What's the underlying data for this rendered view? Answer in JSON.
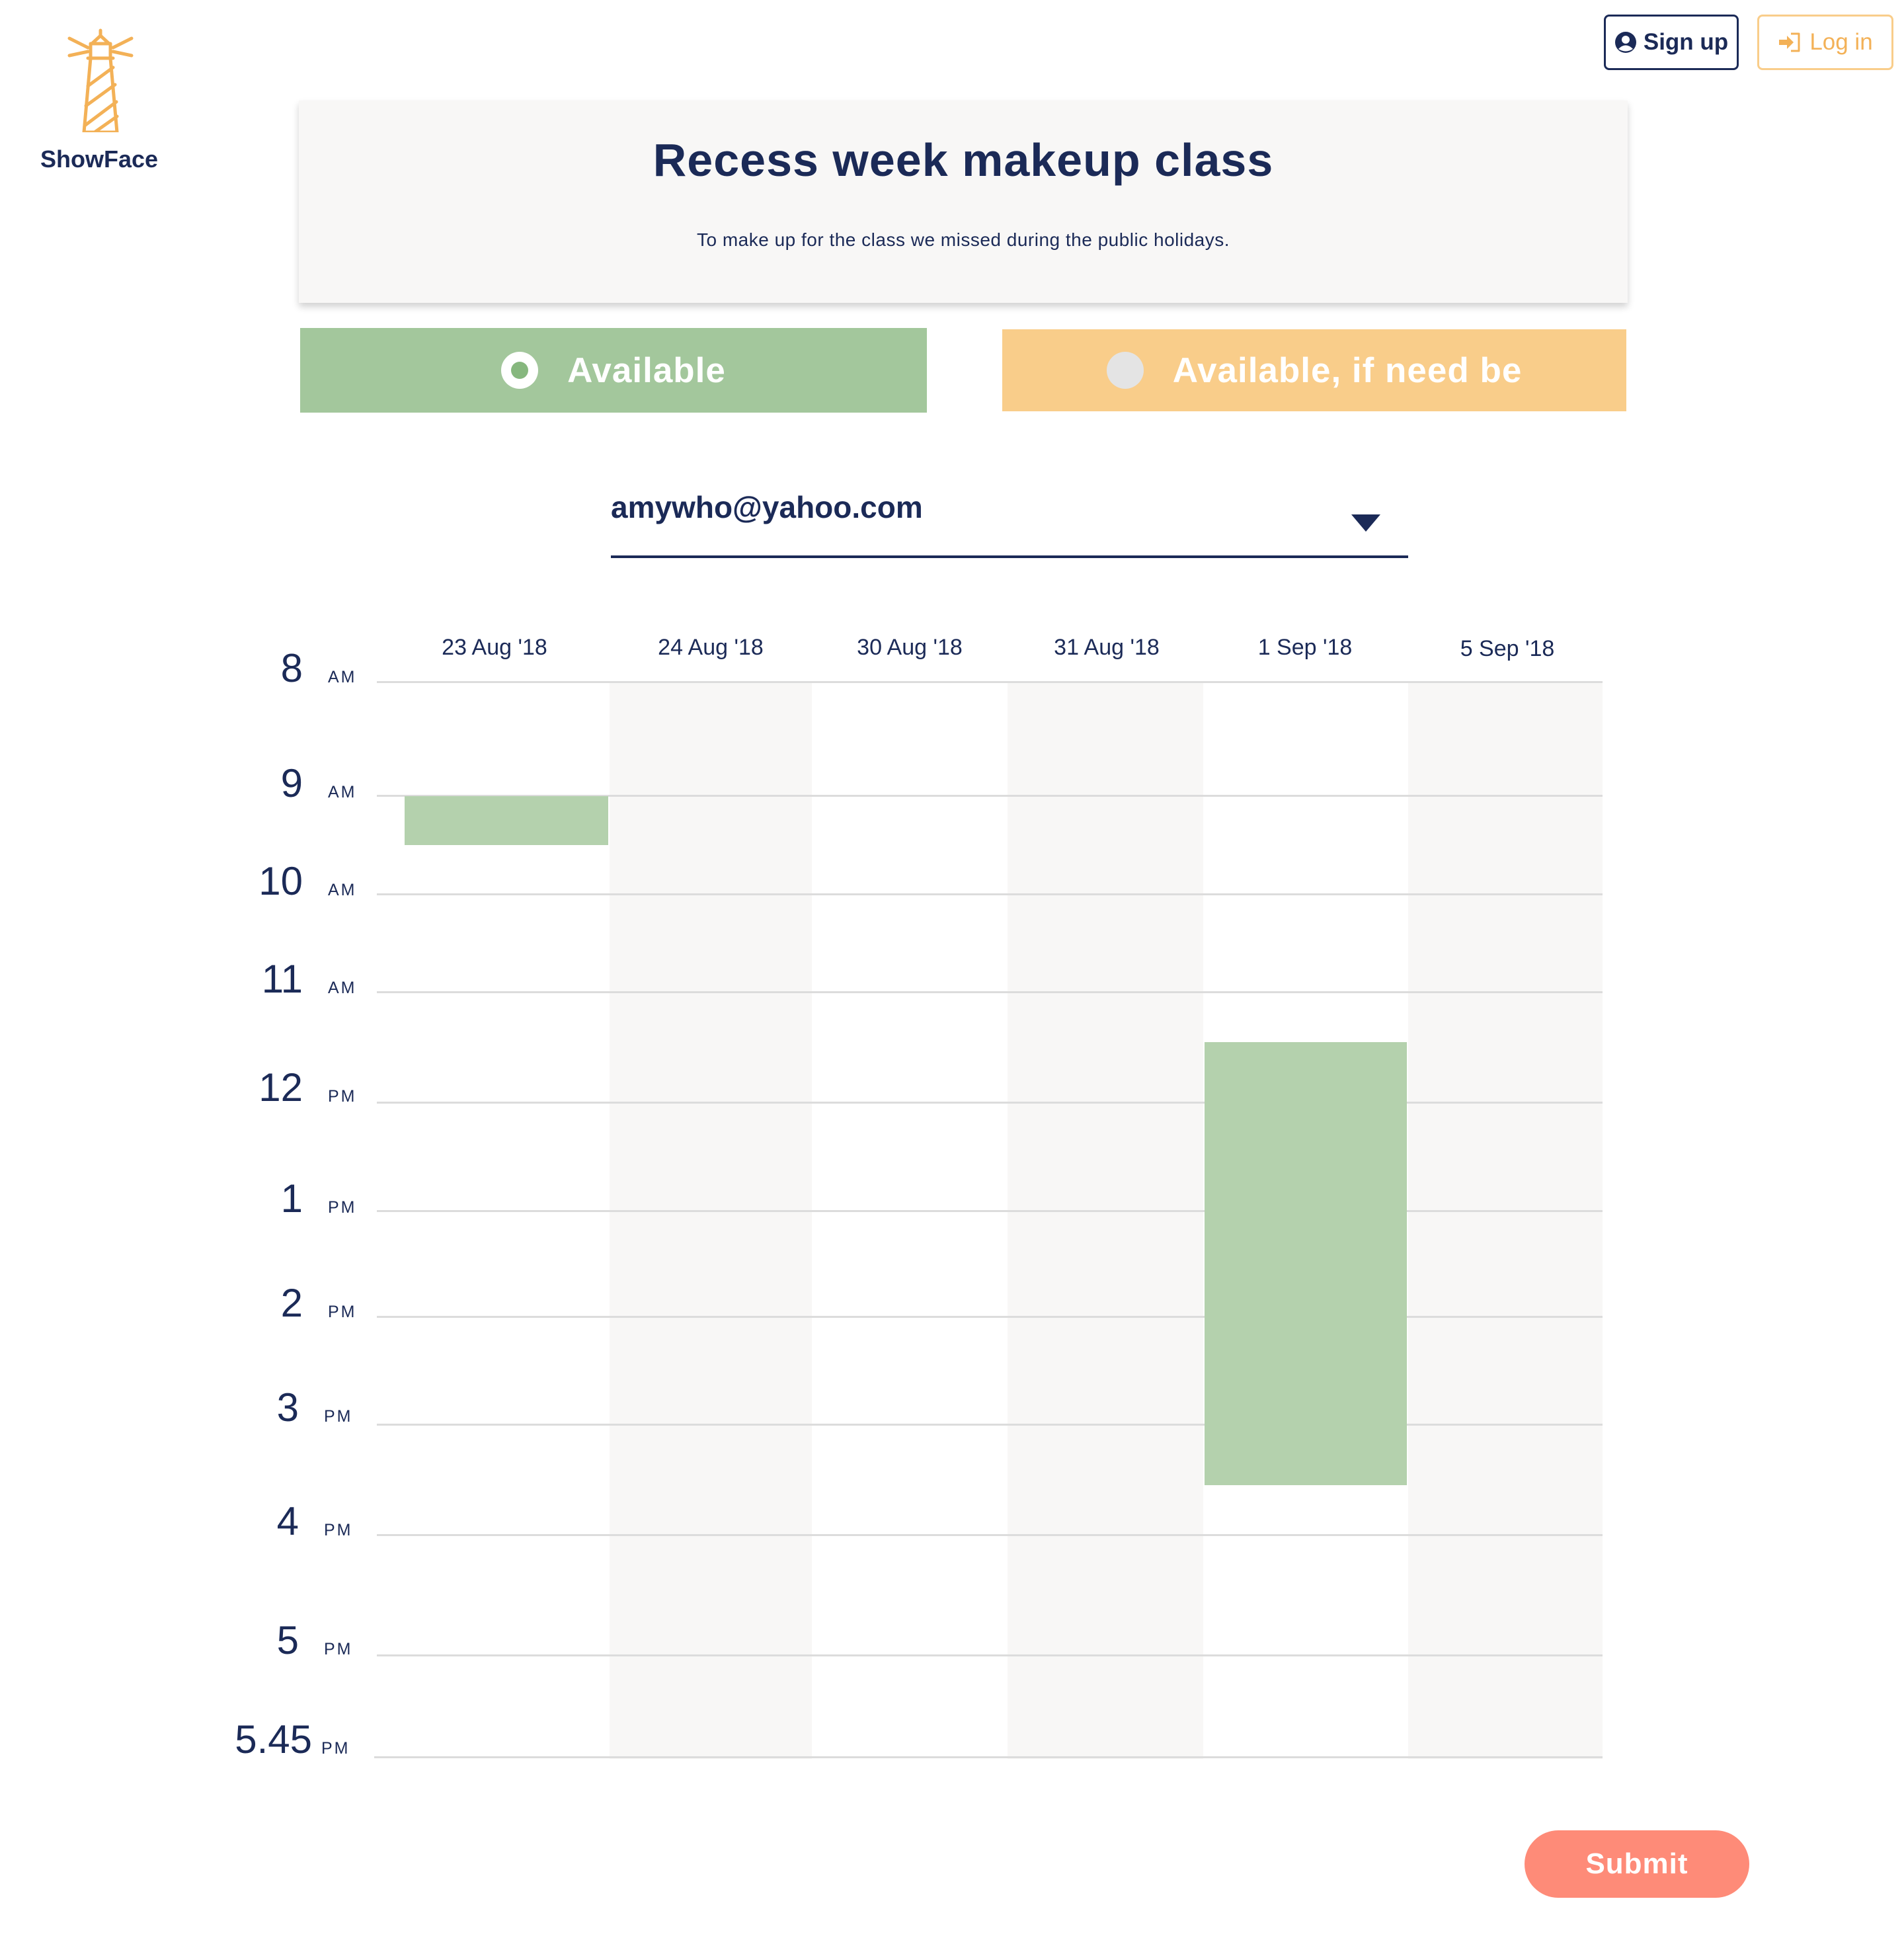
{
  "brand": {
    "name": "ShowFace",
    "logo_icon": "lighthouse-icon",
    "color": "#f3b157"
  },
  "nav": {
    "signup_label": "Sign up",
    "signup_icon": "user-circle-icon",
    "login_label": "Log in",
    "login_icon": "sign-in-icon"
  },
  "event": {
    "title": "Recess week makeup class",
    "description": "To make up for the class we missed during the public holidays."
  },
  "availability": {
    "options": [
      {
        "label": "Available",
        "selected": true,
        "color": "#a3c79c"
      },
      {
        "label": "Available, if need be",
        "selected": false,
        "color": "#f9cd8a"
      }
    ]
  },
  "user_select": {
    "value": "amywho@yahoo.com"
  },
  "schedule": {
    "dates": [
      "23 Aug '18",
      "24 Aug '18",
      "30 Aug '18",
      "31 Aug '18",
      "1 Sep '18",
      "5 Sep '18"
    ],
    "times": [
      {
        "hour": "8",
        "period": "AM"
      },
      {
        "hour": "9",
        "period": "AM"
      },
      {
        "hour": "10",
        "period": "AM"
      },
      {
        "hour": "11",
        "period": "AM"
      },
      {
        "hour": "12",
        "period": "PM"
      },
      {
        "hour": "1",
        "period": "PM"
      },
      {
        "hour": "2",
        "period": "PM"
      },
      {
        "hour": "3",
        "period": "PM"
      },
      {
        "hour": "4",
        "period": "PM"
      },
      {
        "hour": "5",
        "period": "PM"
      },
      {
        "hour": "5.45",
        "period": "PM"
      }
    ],
    "selections": [
      {
        "date": "23 Aug '18",
        "start": "9:00 AM",
        "end": "9:30 AM",
        "type": "Available"
      },
      {
        "date": "1 Sep '18",
        "start": "11:30 AM",
        "end": "3:30 PM",
        "type": "Available"
      }
    ]
  },
  "submit_label": "Submit"
}
